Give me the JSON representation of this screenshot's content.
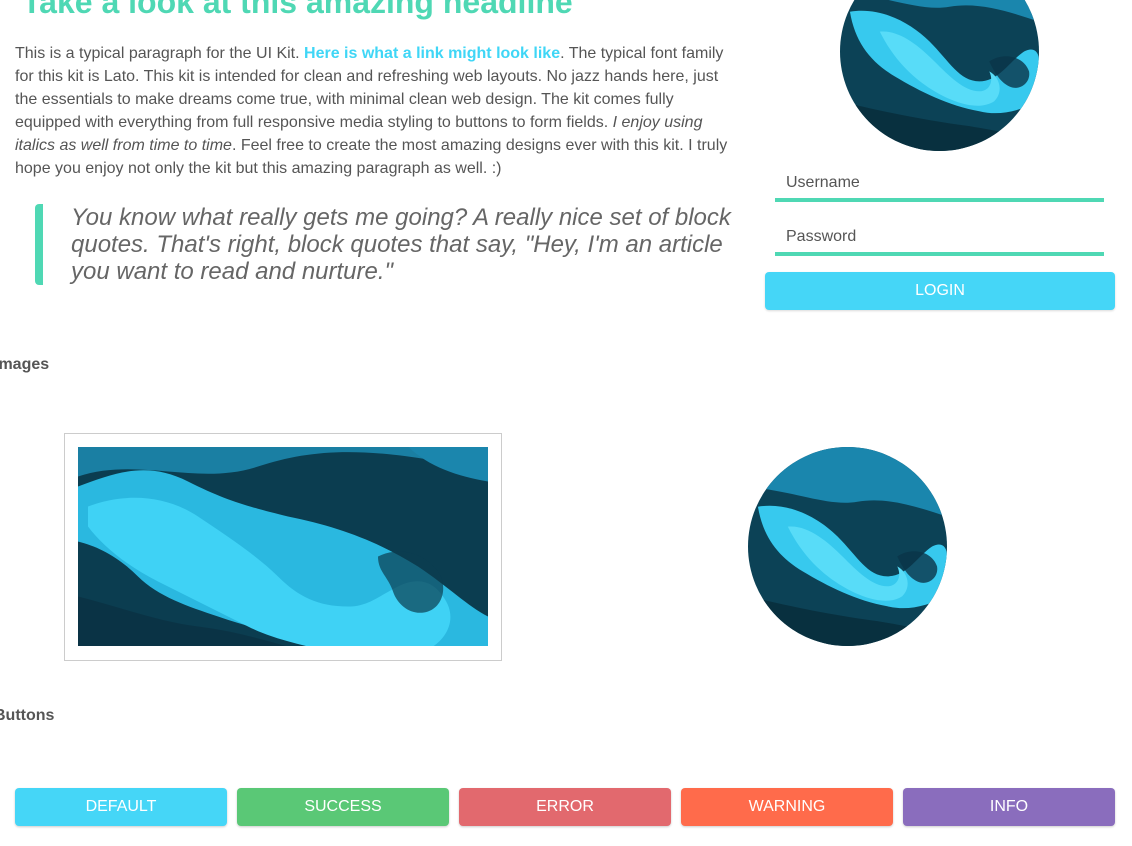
{
  "headline": "Take a look at this amazing headline",
  "intro": {
    "part1": "This is a typical paragraph for the UI Kit. ",
    "link": "Here is what a link might look like",
    "part2": ". The typical font family for this kit is Lato. This kit is intended for clean and refreshing web layouts. No jazz hands here, just the essentials to make dreams come true, with minimal clean web design. The kit comes fully equipped with everything from full responsive media styling to buttons to form fields. ",
    "italic": "I enjoy using italics as well from time to time",
    "part3": ". Feel free to create the most amazing designs ever with this kit. I truly hope you enjoy not only the kit but this amazing paragraph as well. :)"
  },
  "blockquote": "You know what really gets me going? A really nice set of block quotes. That's right, block quotes that say, \"Hey, I'm an article you want to read and nurture.\"",
  "login": {
    "username_placeholder": "Username",
    "password_placeholder": "Password",
    "button_label": "LOGIN"
  },
  "sections": {
    "images_label": "Images",
    "buttons_label": "Buttons"
  },
  "buttons": {
    "default": "DEFAULT",
    "success": "SUCCESS",
    "error": "ERROR",
    "warning": "WARNING",
    "info": "INFO"
  },
  "colors": {
    "accent_green": "#4fd8b4",
    "accent_blue": "#45d6f7",
    "success": "#5ac876",
    "error": "#e2696e",
    "warning": "#ff6b4b",
    "info": "#8a6dbd"
  }
}
